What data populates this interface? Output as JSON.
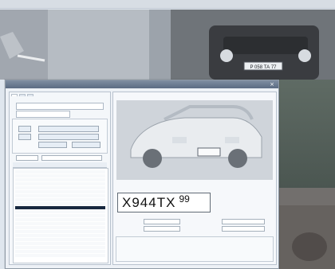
{
  "plate_recognition": {
    "main": "X944TX",
    "region": "99"
  }
}
